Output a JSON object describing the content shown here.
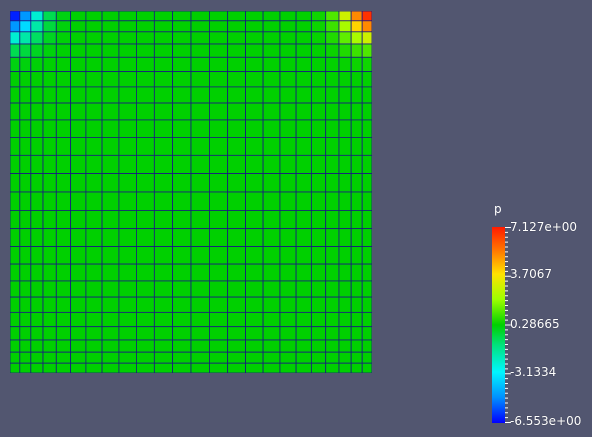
{
  "colorbar": {
    "title": "p",
    "labels": [
      "7.127e+00",
      "3.7067",
      "0.28665",
      "-3.1334",
      "-6.553e+00"
    ]
  },
  "mesh": {
    "grid_cells": 24,
    "field_name": "p",
    "field_range": [
      -6.553,
      7.127
    ],
    "background_color": "#525670",
    "edge_color": "#1a1a80"
  }
}
